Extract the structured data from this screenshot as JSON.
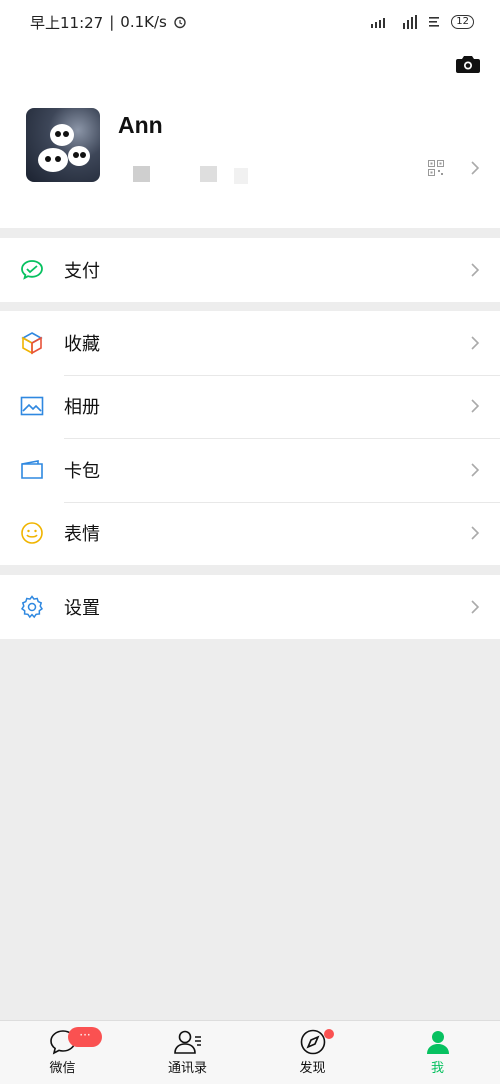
{
  "status_bar": {
    "time": "早上11:27",
    "network_speed": "0.1K/s",
    "battery": "12"
  },
  "profile": {
    "name": "Ann"
  },
  "menu_groups": [
    {
      "items": [
        {
          "label": "支付",
          "icon": "wechat-pay-icon"
        }
      ]
    },
    {
      "items": [
        {
          "label": "收藏",
          "icon": "cube-icon"
        },
        {
          "label": "相册",
          "icon": "image-icon"
        },
        {
          "label": "卡包",
          "icon": "card-icon"
        },
        {
          "label": "表情",
          "icon": "smiley-icon"
        }
      ]
    },
    {
      "items": [
        {
          "label": "设置",
          "icon": "gear-icon"
        }
      ]
    }
  ],
  "tabbar": {
    "tabs": [
      {
        "label": "微信",
        "icon": "chat-icon",
        "badge": "···"
      },
      {
        "label": "通讯录",
        "icon": "contacts-icon"
      },
      {
        "label": "发现",
        "icon": "compass-icon"
      },
      {
        "label": "我",
        "icon": "me-icon",
        "active": true
      }
    ]
  },
  "colors": {
    "accent_green": "#07c160",
    "badge_red": "#fa5151",
    "background": "#ededed"
  }
}
